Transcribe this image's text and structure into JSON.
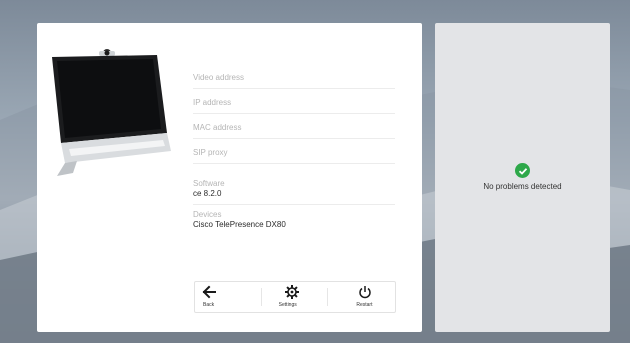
{
  "device_info": {
    "video_address": {
      "label": "Video address",
      "value": ""
    },
    "ip_address": {
      "label": "IP address",
      "value": ""
    },
    "mac_address": {
      "label": "MAC address",
      "value": ""
    },
    "sip_proxy": {
      "label": "SIP proxy",
      "value": ""
    },
    "software": {
      "label": "Software",
      "value": "ce 8.2.0"
    },
    "devices": {
      "label": "Devices",
      "value": "Cisco TelePresence DX80"
    }
  },
  "toolbar": {
    "back_label": "Back",
    "settings_label": "Settings",
    "restart_label": "Restart"
  },
  "status": {
    "message": "No problems detected",
    "icon": "check-circle-icon",
    "color": "#2ea84a"
  },
  "icons": {
    "back": "arrow-left-icon",
    "settings": "gear-icon",
    "restart": "power-icon"
  }
}
